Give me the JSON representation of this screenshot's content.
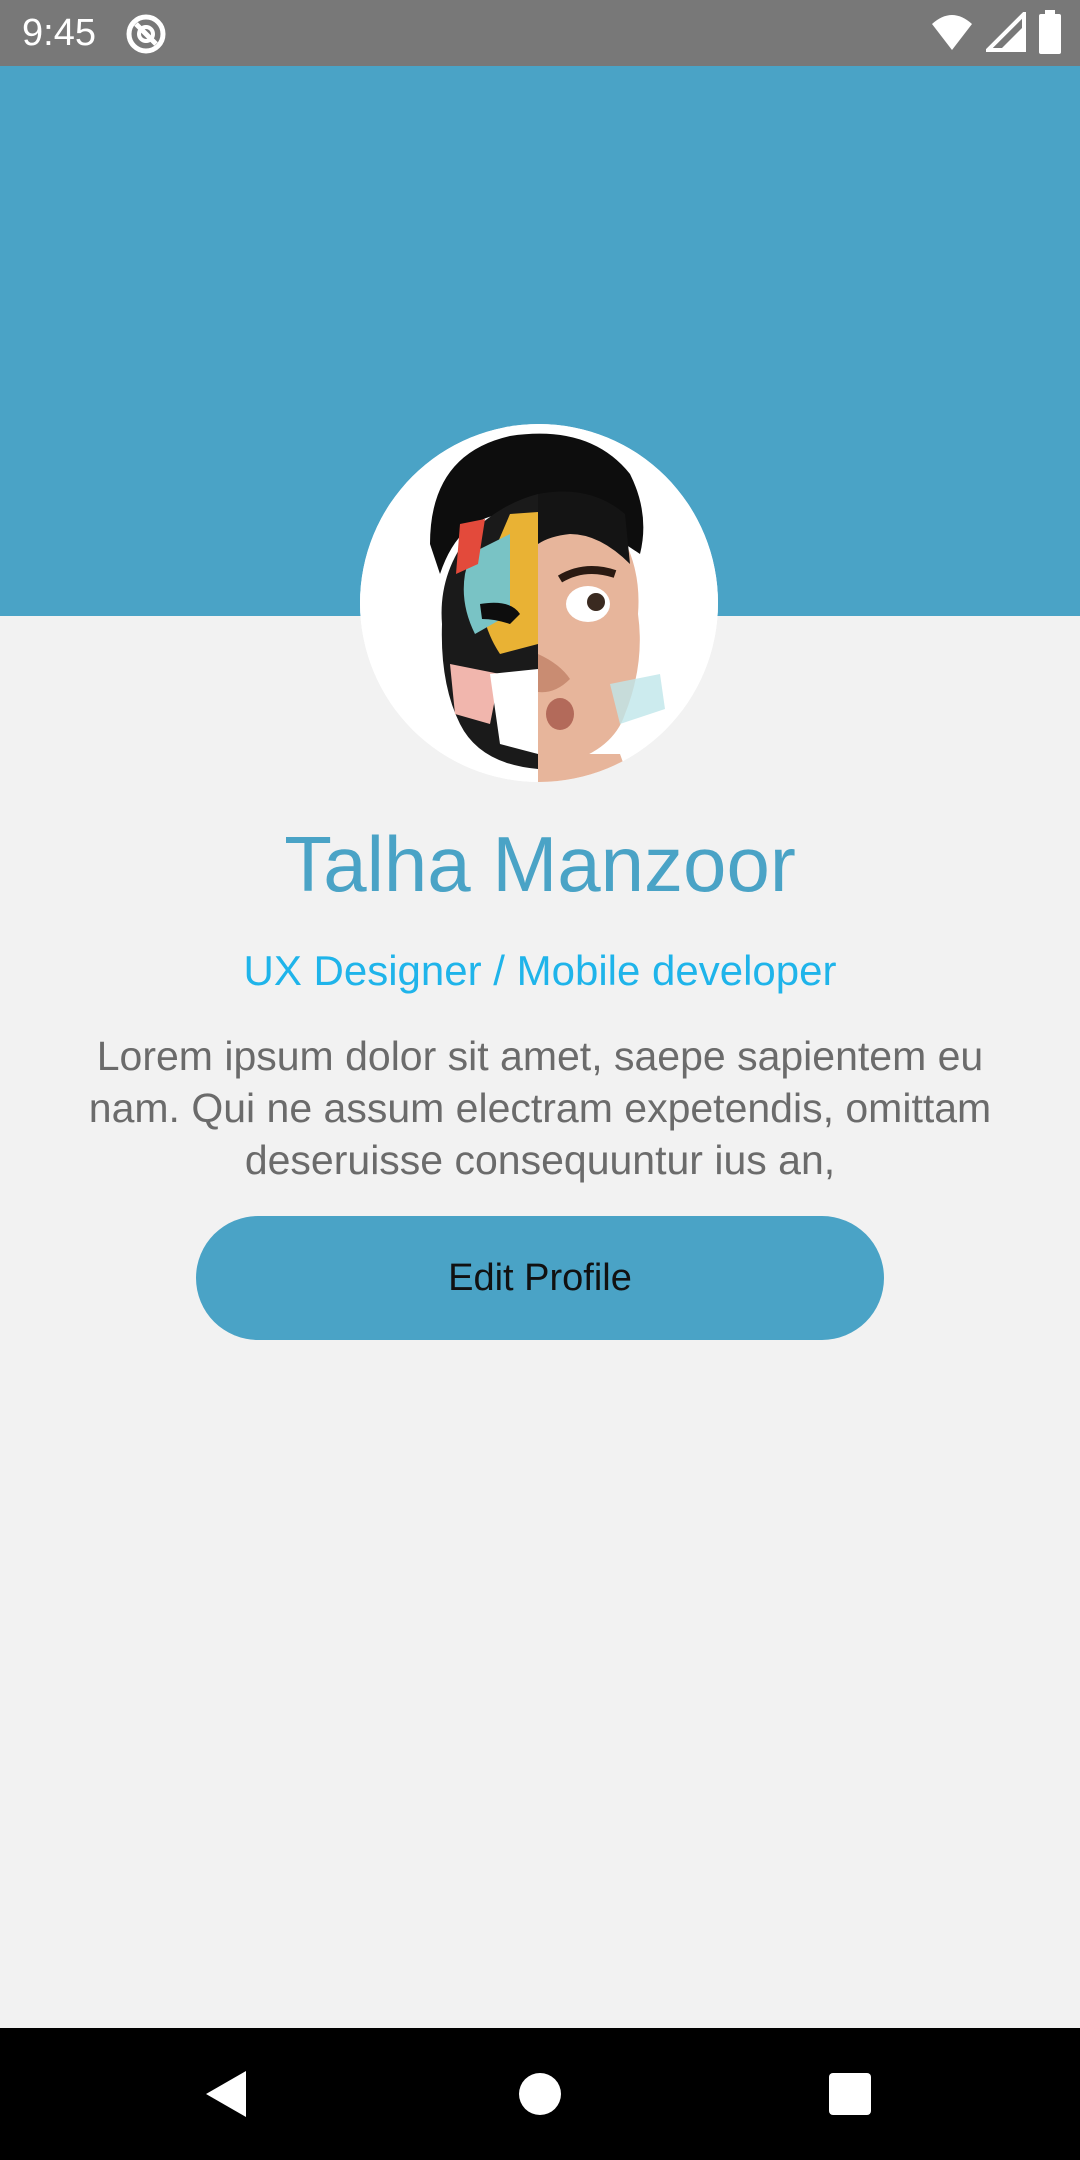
{
  "status_bar": {
    "time": "9:45",
    "icons": [
      "app-notification-icon",
      "wifi-icon",
      "signal-icon",
      "battery-icon"
    ]
  },
  "colors": {
    "header": "#4aa3c6",
    "name": "#4aa3c6",
    "role": "#1fb4ea",
    "bio": "#6b6b6b",
    "button": "#4aa3c6",
    "background": "#f2f2f2"
  },
  "profile": {
    "name": "Talha Manzoor",
    "role": "UX Designer / Mobile developer",
    "bio": "Lorem ipsum dolor sit amet, saepe sapientem eu nam. Qui ne assum electram expetendis, omittam deseruisse consequuntur ius an,",
    "edit_button_label": "Edit Profile"
  },
  "nav_bar": {
    "buttons": [
      "back-icon",
      "home-icon",
      "recents-icon"
    ]
  }
}
